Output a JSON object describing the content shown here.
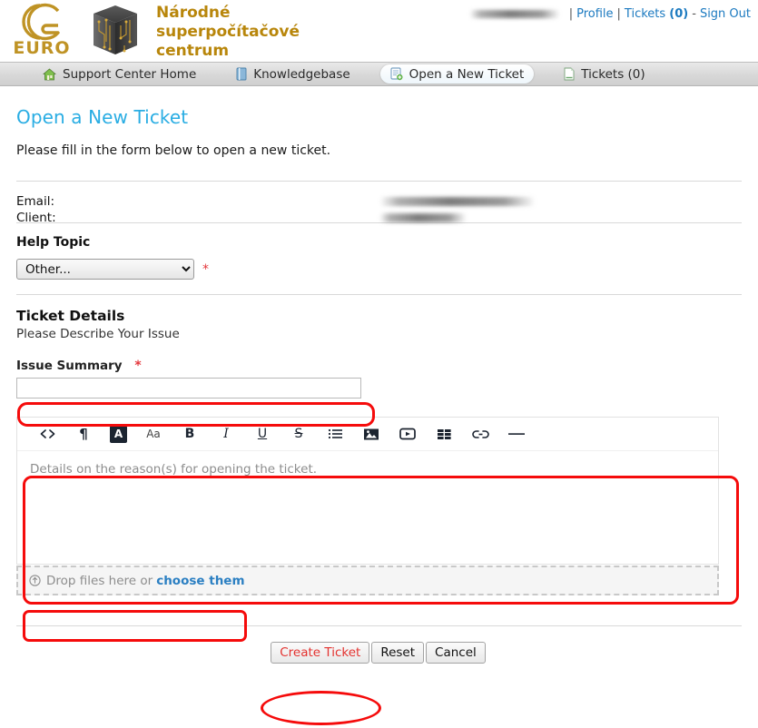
{
  "header": {
    "logo_euro_word": "EURO",
    "logo_euro_icon": "double-c-logo",
    "logo_cube_icon": "cube-circuit-logo",
    "brand_title": "Národné superpočítačové centrum",
    "user_bar": {
      "username_redacted": true,
      "divider": "|",
      "profile_label": "Profile",
      "tickets_label": "Tickets",
      "tickets_count": "(0)",
      "dash": "-",
      "sign_out_label": "Sign Out"
    }
  },
  "nav": {
    "tabs": [
      {
        "label": "Support Center Home",
        "icon": "home-icon",
        "active": false
      },
      {
        "label": "Knowledgebase",
        "icon": "book-icon",
        "active": false
      },
      {
        "label": "Open a New Ticket",
        "icon": "new-ticket-icon",
        "active": true
      },
      {
        "label": "Tickets (0)",
        "icon": "document-icon",
        "active": false
      }
    ]
  },
  "main": {
    "page_title": "Open a New Ticket",
    "page_subtitle": "Please fill in the form below to open a new ticket.",
    "info": {
      "email_label": "Email:",
      "email_value_redacted": true,
      "client_label": "Client:",
      "client_value_redacted": true
    },
    "help_topic": {
      "label": "Help Topic",
      "selected": "Other...",
      "options": [
        "Other..."
      ],
      "required_marker": "*"
    },
    "ticket_details": {
      "heading": "Ticket Details",
      "subheading": "Please Describe Your Issue",
      "issue_summary_label": "Issue Summary",
      "issue_summary_required": "*",
      "issue_summary_value": "",
      "issue_summary_placeholder": ""
    },
    "editor": {
      "placeholder": "Details on the reason(s) for opening the ticket.",
      "toolbar": [
        {
          "name": "source-code-icon",
          "glyph": "<>",
          "active": false
        },
        {
          "name": "paragraph-icon",
          "glyph": "¶",
          "active": false
        },
        {
          "name": "text-color-icon",
          "glyph": "A",
          "active": true
        },
        {
          "name": "font-size-icon",
          "glyph": "Aa",
          "active": false
        },
        {
          "name": "bold-icon",
          "glyph": "B",
          "active": false
        },
        {
          "name": "italic-icon",
          "glyph": "I",
          "active": false
        },
        {
          "name": "underline-icon",
          "glyph": "U",
          "active": false
        },
        {
          "name": "strikethrough-icon",
          "glyph": "S",
          "active": false
        },
        {
          "name": "bullet-list-icon",
          "glyph": "list",
          "active": false
        },
        {
          "name": "image-icon",
          "glyph": "image",
          "active": true
        },
        {
          "name": "video-icon",
          "glyph": "video",
          "active": false
        },
        {
          "name": "table-icon",
          "glyph": "table",
          "active": false
        },
        {
          "name": "link-icon",
          "glyph": "link",
          "active": false
        },
        {
          "name": "horizontal-rule-icon",
          "glyph": "—",
          "active": false
        }
      ]
    },
    "dropzone": {
      "icon": "upload-arrow-icon",
      "text": "Drop files here or",
      "choose_label": "choose them"
    },
    "buttons": {
      "create_label": "Create Ticket",
      "reset_label": "Reset",
      "cancel_label": "Cancel"
    }
  },
  "annotations": {
    "color": "#f50b0b",
    "highlights": [
      "issue-summary-input",
      "editor-body",
      "dropzone-choose",
      "create-ticket-button"
    ]
  },
  "colors": {
    "brand_gold": "#b8860b",
    "title_blue": "#29ade3",
    "link_blue": "#1c7ac0",
    "required_red": "#e4373c",
    "annotation_red": "#f50b0b"
  }
}
